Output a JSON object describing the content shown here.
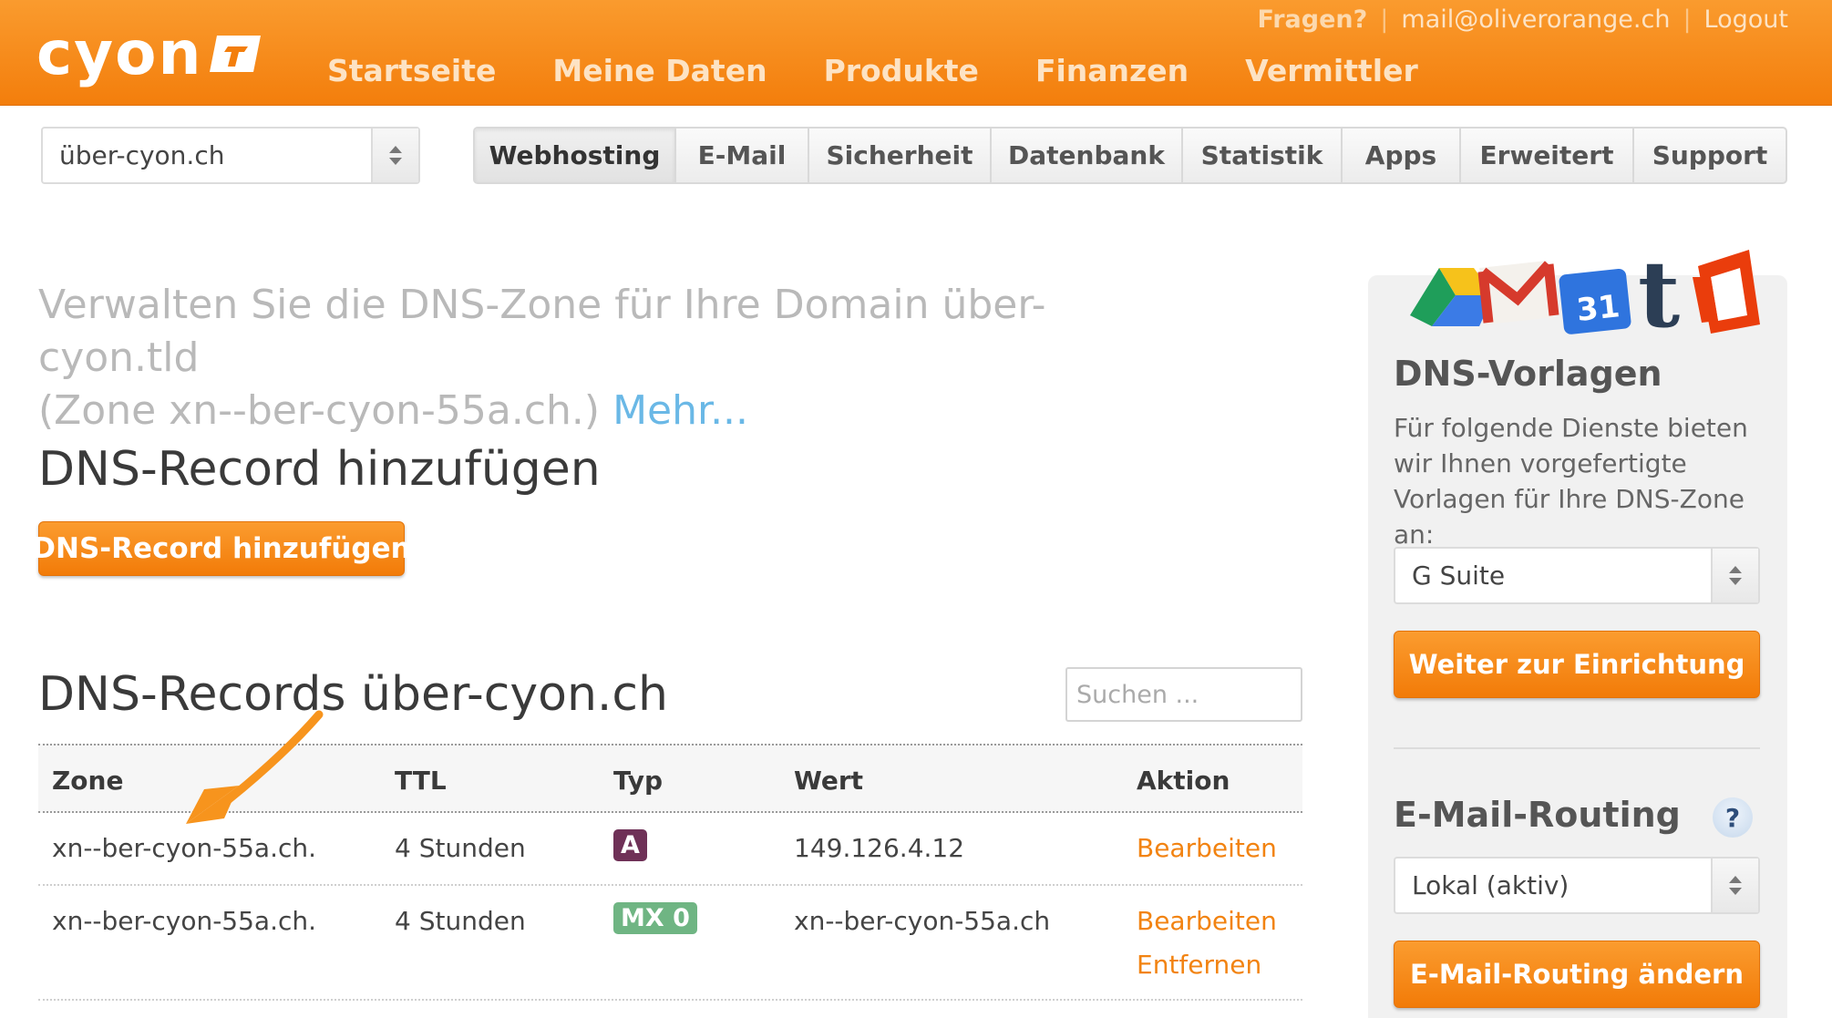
{
  "header": {
    "logo_text": "cyon",
    "nav": [
      "Startseite",
      "Meine Daten",
      "Produkte",
      "Finanzen",
      "Vermittler"
    ],
    "question_label": "Fragen?",
    "email": "mail@oliverorange.ch",
    "logout_label": "Logout"
  },
  "domain_select": {
    "value": "über-cyon.ch"
  },
  "tabs": [
    {
      "label": "Webhosting",
      "active": true
    },
    {
      "label": "E-Mail"
    },
    {
      "label": "Sicherheit"
    },
    {
      "label": "Datenbank"
    },
    {
      "label": "Statistik"
    },
    {
      "label": "Apps"
    },
    {
      "label": "Erweitert"
    },
    {
      "label": "Support"
    }
  ],
  "intro": {
    "line1": "Verwalten Sie die DNS-Zone für Ihre Domain über-cyon.tld",
    "line2": "(Zone xn--ber-cyon-55a.ch.)",
    "more_link": "Mehr..."
  },
  "add_section": {
    "heading": "DNS-Record hinzufügen",
    "button_label": "DNS-Record hinzufügen"
  },
  "records_section": {
    "heading": "DNS-Records über-cyon.ch",
    "search_placeholder": "Suchen ..."
  },
  "table": {
    "headers": {
      "zone": "Zone",
      "ttl": "TTL",
      "typ": "Typ",
      "wert": "Wert",
      "aktion": "Aktion"
    },
    "rows": [
      {
        "zone": "xn--ber-cyon-55a.ch.",
        "ttl": "4 Stunden",
        "typ": "A",
        "wert": "149.126.4.12",
        "actions": [
          "Bearbeiten"
        ]
      },
      {
        "zone": "xn--ber-cyon-55a.ch.",
        "ttl": "4 Stunden",
        "typ": "MX 0",
        "wert": "xn--ber-cyon-55a.ch",
        "actions": [
          "Bearbeiten",
          "Entfernen"
        ]
      }
    ]
  },
  "sidebar": {
    "dns_templates": {
      "heading": "DNS-Vorlagen",
      "description": "Für folgende Dienste bieten wir Ihnen vorgefertigte Vorlagen für Ihre DNS-Zone an:",
      "select_value": "G Suite",
      "button_label": "Weiter zur Einrichtung",
      "app_icons": [
        "google-drive-icon",
        "gmail-icon",
        "google-calendar-icon",
        "tumblr-icon",
        "office-icon"
      ],
      "calendar_day": "31",
      "tumblr_letter": "t"
    },
    "mail_routing": {
      "heading": "E-Mail-Routing",
      "help_label": "?",
      "select_value": "Lokal (aktiv)",
      "button_label": "E-Mail-Routing ändern"
    }
  },
  "colors": {
    "brand_orange": "#f37e0c",
    "link_orange": "#f28311",
    "link_blue": "#6ab8e6",
    "badge_a": "#6f3157",
    "badge_mx": "#6fb583"
  }
}
